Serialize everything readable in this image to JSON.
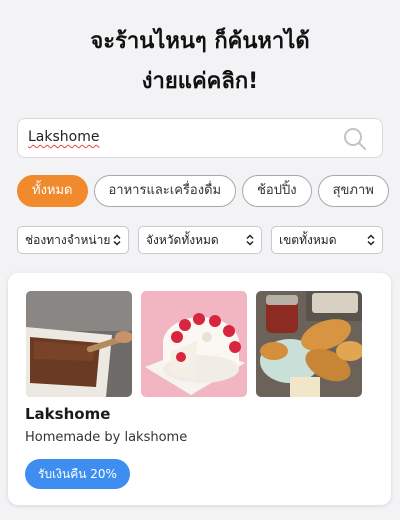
{
  "headline": {
    "line1": "จะร้านไหนๆ ก็ค้นหาได้",
    "line2": "ง่ายแค่คลิก!"
  },
  "search": {
    "value": "Lakshome",
    "icon": "search-icon"
  },
  "categories": [
    {
      "label": "ทั้งหมด",
      "active": true
    },
    {
      "label": "อาหารและเครื่องดื่ม",
      "active": false
    },
    {
      "label": "ช้อปปิ้ง",
      "active": false
    },
    {
      "label": "สุขภาพ",
      "active": false
    }
  ],
  "filters": {
    "channel": "ช่องทางจำหน่าย",
    "province": "จังหวัดทั้งหมด",
    "district": "เขตทั้งหมด"
  },
  "store": {
    "name": "Lakshome",
    "description": "Homemade by lakshome",
    "badge": "รับเงินคืน 20%"
  },
  "colors": {
    "accent": "#f08a2c",
    "badge": "#3d8ef0",
    "background": "#f3f3f5"
  }
}
